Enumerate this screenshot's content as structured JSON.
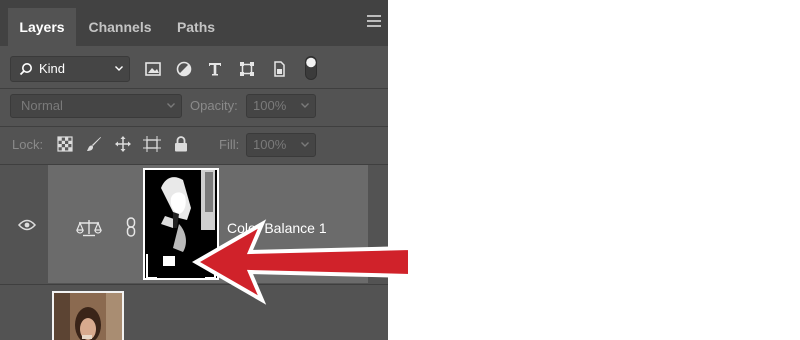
{
  "tabs": {
    "layers": "Layers",
    "channels": "Channels",
    "paths": "Paths"
  },
  "filter": {
    "kind_label": "Kind",
    "icons": [
      "image-filter-icon",
      "adjustment-filter-icon",
      "type-filter-icon",
      "shape-filter-icon",
      "smart-object-filter-icon",
      "filter-toggle-icon"
    ]
  },
  "blend": {
    "mode": "Normal",
    "opacity_label": "Opacity:",
    "opacity_value": "100%"
  },
  "lock": {
    "label": "Lock:",
    "icons": [
      "lock-transparent-pixels-icon",
      "lock-image-pixels-icon",
      "lock-position-icon",
      "lock-artboard-icon",
      "lock-all-icon"
    ],
    "fill_label": "Fill:",
    "fill_value": "100%"
  },
  "layers": [
    {
      "name": "Color Balance 1",
      "type": "adjustment",
      "visible": true,
      "selected": true
    },
    {
      "name": "",
      "type": "photo",
      "visible": true,
      "selected": false
    }
  ],
  "colors": {
    "panel_bg": "#535353",
    "tab_bar_bg": "#424242",
    "selected_row": "#6b6b6b",
    "annotation_arrow": "#d0222a"
  }
}
